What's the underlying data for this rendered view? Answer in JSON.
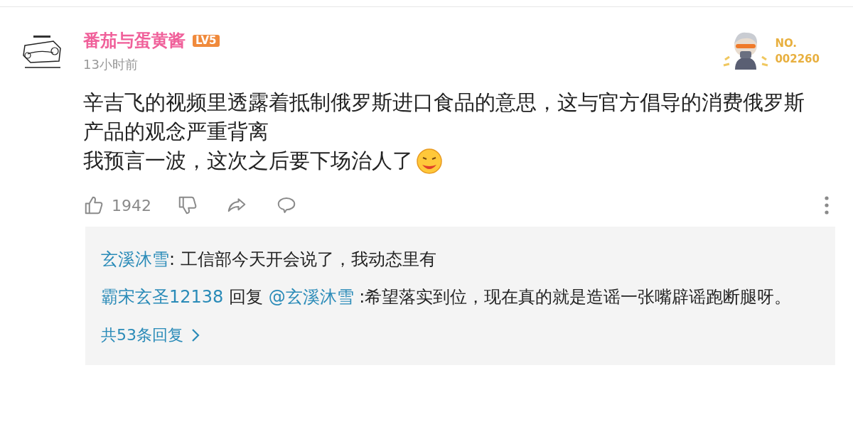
{
  "comment": {
    "user": {
      "name": "番茄与蛋黄酱",
      "level": "LV5",
      "time": "13小时前"
    },
    "badge": {
      "label": "NO.",
      "number": "002260"
    },
    "paragraphs": [
      "辛吉飞的视频里透露着抵制俄罗斯进口食品的意思，这与官方倡导的消费俄罗斯产品的观念严重背离",
      "我预言一波，这次之后要下场治人了"
    ],
    "like_count": "1942"
  },
  "replies": [
    {
      "author": "玄溪沐雪",
      "text": ": 工信部今天开会说了，我动态里有"
    },
    {
      "author": "霸宋玄圣12138",
      "connector": "回复",
      "target": "@玄溪沐雪",
      "text": ":希望落实到位，现在真的就是造谣一张嘴辟谣跑断腿呀。"
    }
  ],
  "more_replies": "共53条回复"
}
